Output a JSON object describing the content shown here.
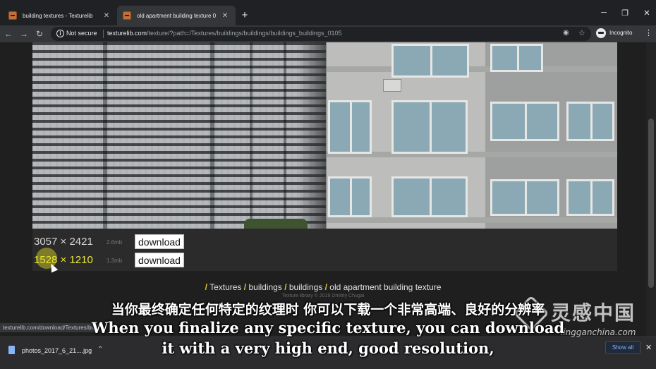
{
  "browser": {
    "tabs": [
      {
        "title": "building textures - Texturelib",
        "close": "✕"
      },
      {
        "title": "old apartment building texture 0",
        "close": "✕"
      }
    ],
    "new_tab": "+",
    "window_controls": {
      "minimize": "─",
      "maximize": "❐",
      "close": "✕"
    },
    "nav": {
      "back": "←",
      "forward": "→",
      "reload": "↻"
    },
    "omnibox": {
      "security_label": "Not secure",
      "url_host": "texturelib.com",
      "url_path": "/texture/?path=/Textures/buildings/buildings/buildings_buildings_0105"
    },
    "profile_label": "Incognito",
    "menu": "⋮"
  },
  "page": {
    "downloads": [
      {
        "resolution": "3057 × 2421",
        "size": "2.6mb",
        "button": "download"
      },
      {
        "resolution": "1528 × 1210",
        "size": "1.3mb",
        "button": "download"
      }
    ],
    "breadcrumb": {
      "sep": "/",
      "items": [
        "Textures",
        "buildings",
        "buildings",
        "old apartment building texture"
      ]
    },
    "copyright": "Texture library © 2019 Dmitriy Chugai",
    "status_url": "texturelib.com/download/Textures/buil"
  },
  "download_shelf": {
    "file_name": "photos_2017_6_21....jpg",
    "chevron": "⌃",
    "show_all": "Show all",
    "close": "✕"
  },
  "subtitles": {
    "chinese": "当你最终确定任何特定的纹理时 你可以下载一个非常高端、良好的分辨率",
    "english_line1": "When you finalize any specific texture, you can download",
    "english_line2": "it with a very high end, good resolution,"
  },
  "watermark": {
    "cn": "灵感中国",
    "en": "lingganchina.com"
  },
  "colors": {
    "breadcrumb_slash": "#d8c63a",
    "highlight_resolution": "#e9e63a",
    "link_blue": "#8ab4f8"
  }
}
